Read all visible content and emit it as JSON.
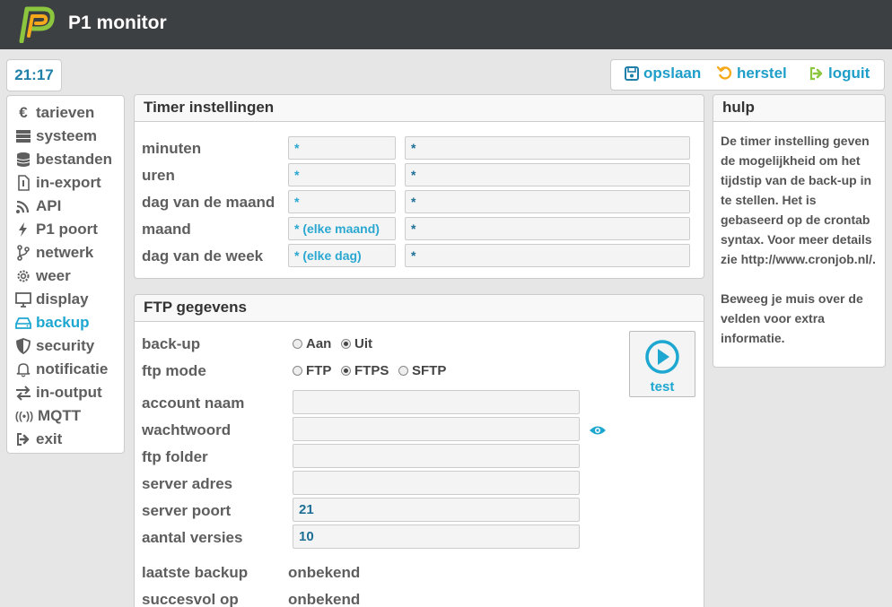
{
  "header": {
    "title": "P1 monitor",
    "logo": "p1-logo"
  },
  "clock": "21:17",
  "actions": {
    "save": "opslaan",
    "undo": "herstel",
    "logout": "loguit"
  },
  "sidebar": {
    "items": [
      {
        "label": "tarieven",
        "icon": "euro-icon"
      },
      {
        "label": "systeem",
        "icon": "server-icon"
      },
      {
        "label": "bestanden",
        "icon": "database-icon"
      },
      {
        "label": "in-export",
        "icon": "file-icon"
      },
      {
        "label": "API",
        "icon": "rss-icon"
      },
      {
        "label": "P1 poort",
        "icon": "bolt-icon"
      },
      {
        "label": "netwerk",
        "icon": "branch-icon"
      },
      {
        "label": "weer",
        "icon": "gear-icon"
      },
      {
        "label": "display",
        "icon": "monitor-icon"
      },
      {
        "label": "backup",
        "icon": "hdd-icon",
        "active": true
      },
      {
        "label": "security",
        "icon": "shield-icon"
      },
      {
        "label": "notificatie",
        "icon": "bell-icon"
      },
      {
        "label": "in-output",
        "icon": "exchange-icon"
      },
      {
        "label": "MQTT",
        "icon": "broadcast-icon",
        "prefix": "((•))"
      },
      {
        "label": "exit",
        "icon": "exit-icon"
      }
    ]
  },
  "timer": {
    "title": "Timer instellingen",
    "rows": [
      {
        "label": "minuten",
        "hint": "*",
        "value": "*"
      },
      {
        "label": "uren",
        "hint": "*",
        "value": "*"
      },
      {
        "label": "dag van de maand",
        "hint": "*",
        "value": "*"
      },
      {
        "label": "maand",
        "hint": "* (elke maand)",
        "value": "*"
      },
      {
        "label": "dag van de week",
        "hint": "* (elke dag)",
        "value": "*"
      }
    ]
  },
  "ftp": {
    "title": "FTP gegevens",
    "backup_label": "back-up",
    "backup_options": [
      "Aan",
      "Uit"
    ],
    "backup_selected": "Uit",
    "mode_label": "ftp mode",
    "mode_options": [
      "FTP",
      "FTPS",
      "SFTP"
    ],
    "mode_selected": "FTPS",
    "test_label": "test",
    "fields": [
      {
        "label": "account naam",
        "value": ""
      },
      {
        "label": "wachtwoord",
        "value": ""
      },
      {
        "label": "ftp folder",
        "value": ""
      },
      {
        "label": "server adres",
        "value": ""
      },
      {
        "label": "server poort",
        "value": "21"
      },
      {
        "label": "aantal versies",
        "value": "10"
      }
    ],
    "status": [
      {
        "label": "laatste backup",
        "value": "onbekend"
      },
      {
        "label": "succesvol op",
        "value": "onbekend"
      }
    ]
  },
  "help": {
    "title": "hulp",
    "p1": "De timer instelling geven de mogelijkheid om het tijdstip van de back-up in te stellen. Het is gebaseerd op de crontab syntax. Voor meer details zie http://www.cronjob.nl/.",
    "p2": "Beweeg je muis over de velden voor extra informatie."
  },
  "colors": {
    "accent": "#1ea8d1",
    "topbar": "#3d4042",
    "logo_green": "#8cc63f",
    "logo_yellow": "#f6a81b"
  }
}
